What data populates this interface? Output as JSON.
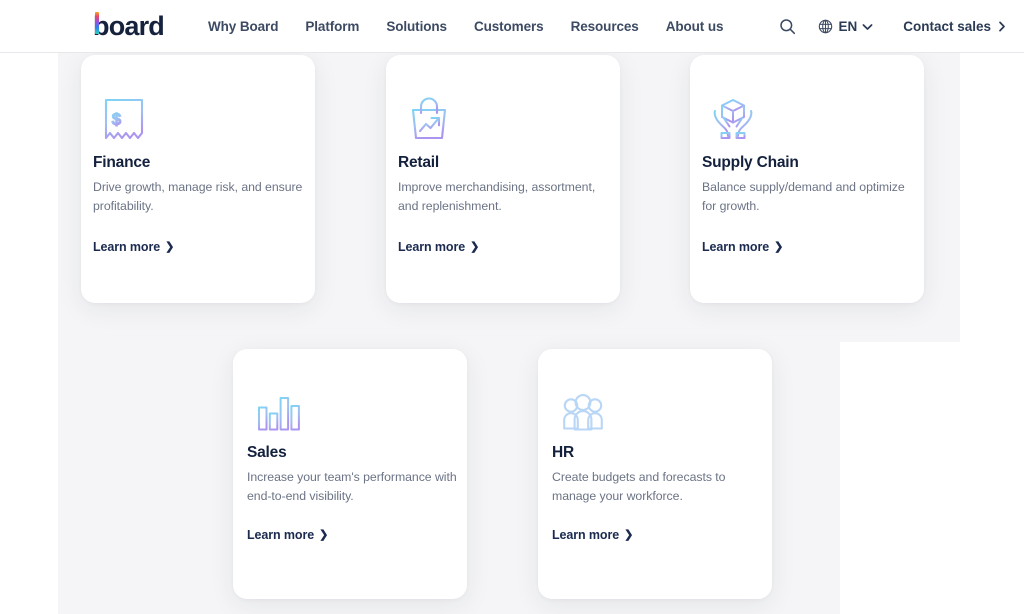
{
  "header": {
    "logo_text": "board",
    "logo_icon": "board-logo",
    "nav": [
      {
        "label": "Why Board"
      },
      {
        "label": "Platform"
      },
      {
        "label": "Solutions"
      },
      {
        "label": "Customers"
      },
      {
        "label": "Resources"
      },
      {
        "label": "About us"
      }
    ],
    "search_icon": "search-icon",
    "globe_icon": "globe-icon",
    "language": "EN",
    "language_chevron": "chevron-down-icon",
    "contact_label": "Contact sales",
    "contact_chevron": "chevron-right-icon"
  },
  "colors": {
    "page_background": "#ffffff",
    "panel_background": "#f5f5f7",
    "card_background": "#ffffff",
    "title_text": "#14213d",
    "body_text": "#6b7385",
    "nav_text": "#3c4a63",
    "icon_gradient_start": "#7fd4f5",
    "icon_gradient_end": "#a996f0"
  },
  "cards": [
    {
      "id": "finance",
      "icon": "receipt-dollar-icon",
      "title": "Finance",
      "description": "Drive growth, manage risk, and ensure profitability.",
      "link_label": "Learn more",
      "link_chevron": "chevron-right-icon"
    },
    {
      "id": "retail",
      "icon": "shopping-bag-trend-icon",
      "title": "Retail",
      "description": "Improve merchandising, assortment, and replenishment.",
      "link_label": "Learn more",
      "link_chevron": "chevron-right-icon"
    },
    {
      "id": "supply-chain",
      "icon": "hands-holding-box-icon",
      "title": "Supply Chain",
      "description": "Balance supply/demand and optimize for growth.",
      "link_label": "Learn more",
      "link_chevron": "chevron-right-icon"
    },
    {
      "id": "sales",
      "icon": "bar-chart-icon",
      "title": "Sales",
      "description": "Increase your team's performance with end-to-end visibility.",
      "link_label": "Learn more",
      "link_chevron": "chevron-right-icon"
    },
    {
      "id": "hr",
      "icon": "people-group-icon",
      "title": "HR",
      "description": "Create budgets and forecasts to manage your workforce.",
      "link_label": "Learn more",
      "link_chevron": "chevron-right-icon"
    }
  ]
}
